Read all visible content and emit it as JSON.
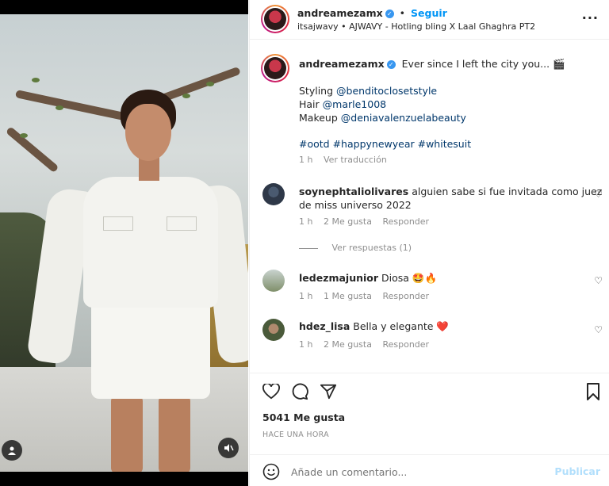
{
  "post": {
    "author": "andreamezamx",
    "follow_label": "Seguir",
    "audio_line": "itsajwavy • AJWAVY - Hotling bling X Laal Ghaghra PT2",
    "more_icon": "more-horizontal-icon"
  },
  "caption": {
    "author": "andreamezamx",
    "text": "Ever since I left the city you... 🎬",
    "styling_label": "Styling",
    "styling_handle": "@benditoclosetstyle",
    "hair_label": "Hair",
    "hair_handle": "@marle1008",
    "makeup_label": "Makeup",
    "makeup_handle": "@deniavalenzuelabeauty",
    "hashtags": "#ootd #happynewyear #whitesuit",
    "time": "1 h",
    "translate": "Ver traducción"
  },
  "comments": [
    {
      "user": "soynephtaliolivares",
      "text": "alguien sabe si fue invitada como juez",
      "text2": "de miss universo 2022",
      "time": "1 h",
      "likes": "2 Me gusta",
      "reply": "Responder",
      "view_replies": "Ver respuestas (1)"
    },
    {
      "user": "ledezmajunior",
      "text": "Diosa 🤩🔥",
      "time": "1 h",
      "likes": "1 Me gusta",
      "reply": "Responder"
    },
    {
      "user": "hdez_lisa",
      "text": "Bella y elegante ❤️",
      "time": "1 h",
      "likes": "2 Me gusta",
      "reply": "Responder"
    }
  ],
  "stats": {
    "likes": "5041 Me gusta",
    "posted": "HACE UNA HORA"
  },
  "compose": {
    "placeholder": "Añade un comentario...",
    "publish": "Publicar"
  },
  "colors": {
    "accent": "#0095f6",
    "text": "#262626",
    "muted": "#8e8e8e",
    "link": "#00376b"
  }
}
